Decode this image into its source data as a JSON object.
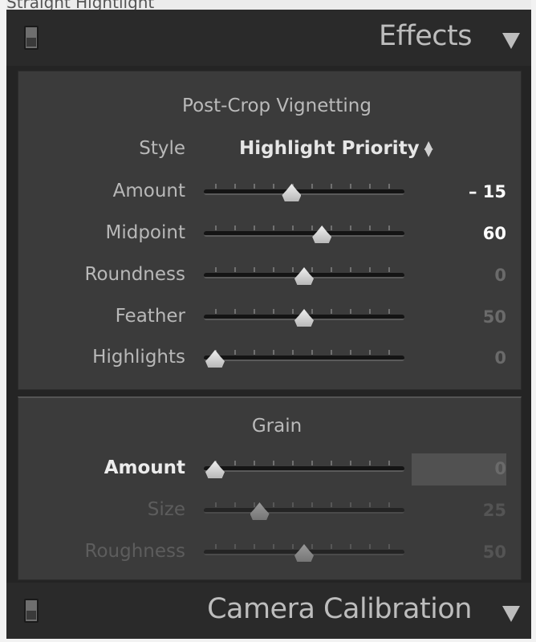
{
  "top_cut_text": "Straight Hightlight",
  "effects_panel": {
    "title": "Effects",
    "collapse_icon": "triangle-down-icon",
    "switch_icon": "panel-toggle-switch-icon",
    "vignetting": {
      "title": "Post-Crop Vignetting",
      "style_label": "Style",
      "style_value": "Highlight Priority",
      "style_icon": "up-down-arrows-icon",
      "sliders": [
        {
          "label": "Amount",
          "value": "– 15",
          "position": 0.43,
          "state": "bright"
        },
        {
          "label": "Midpoint",
          "value": "60",
          "position": 0.6,
          "state": "bright"
        },
        {
          "label": "Roundness",
          "value": "0",
          "position": 0.5,
          "state": "dim"
        },
        {
          "label": "Feather",
          "value": "50",
          "position": 0.5,
          "state": "dim"
        },
        {
          "label": "Highlights",
          "value": "0",
          "position": 0.0,
          "state": "dim"
        }
      ]
    },
    "grain": {
      "title": "Grain",
      "sliders": [
        {
          "label": "Amount",
          "value": "0",
          "position": 0.0,
          "state": "active"
        },
        {
          "label": "Size",
          "value": "25",
          "position": 0.25,
          "state": "disabled"
        },
        {
          "label": "Roughness",
          "value": "50",
          "position": 0.5,
          "state": "disabled"
        }
      ]
    }
  },
  "calibration_panel": {
    "title": "Camera Calibration",
    "collapse_icon": "triangle-down-icon",
    "switch_icon": "panel-toggle-switch-icon"
  },
  "colors": {
    "panel_background": "#3b3b3b",
    "header_background": "#2a2a2a",
    "label_text": "#b8b8b8",
    "active_value": "#ffffff",
    "thumb": "#e0e0e0"
  }
}
